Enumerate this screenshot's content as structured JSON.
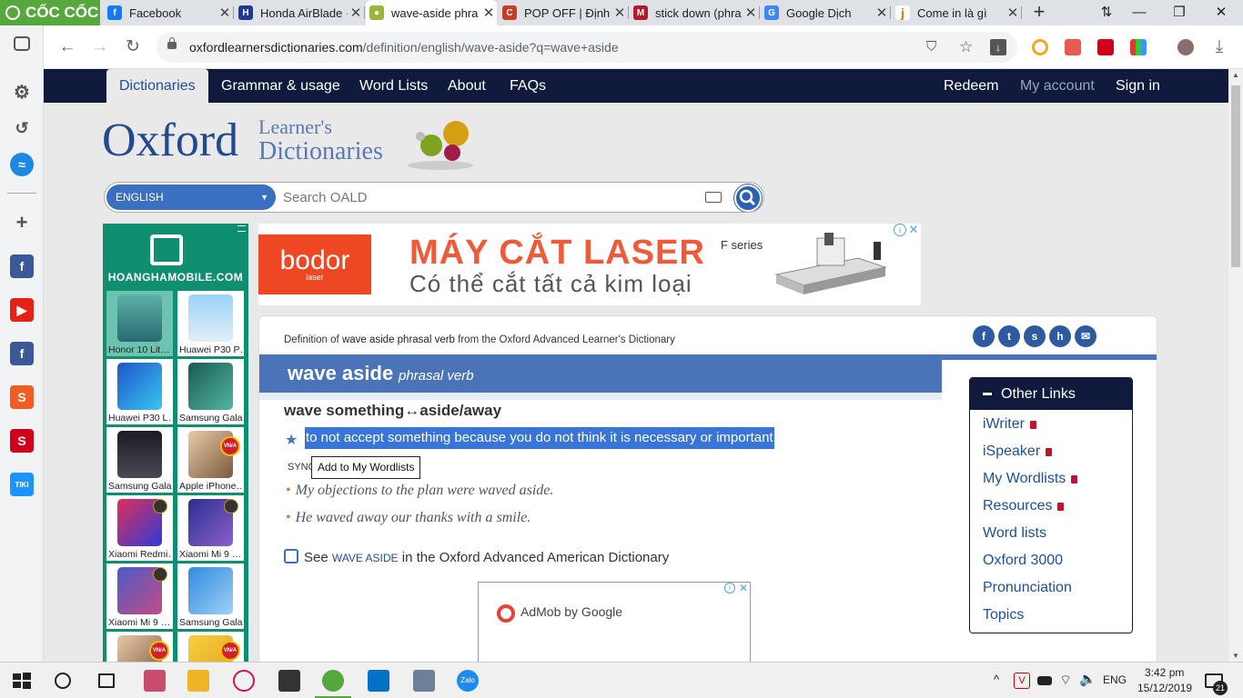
{
  "browser": {
    "brand": "CỐC CỐC",
    "tabs": [
      {
        "title": "Facebook",
        "favicon": "facebook-icon",
        "color": "#1877f2"
      },
      {
        "title": "Honda AirBlade ·",
        "favicon": "honda-icon",
        "color": "#1f3a93"
      },
      {
        "title": "wave-aside phra",
        "favicon": "oxford-icon",
        "color": "#9ab63a",
        "active": true
      },
      {
        "title": "POP OFF | Định n",
        "favicon": "cambridge-icon",
        "color": "#c63c24"
      },
      {
        "title": "stick down (phra",
        "favicon": "macmillan-icon",
        "color": "#b01c2e"
      },
      {
        "title": "Google Dịch",
        "favicon": "google-translate-icon",
        "color": "#4285f4"
      },
      {
        "title": "Come in là gì",
        "favicon": "j-icon",
        "color": "#e07b00"
      }
    ],
    "url_domain": "oxfordlearnersdictionaries.com",
    "url_path": "/definition/english/wave-aside?q=wave+aside"
  },
  "nav": {
    "dictionaries": "Dictionaries",
    "grammar": "Grammar & usage",
    "word_lists": "Word Lists",
    "about": "About",
    "faqs": "FAQs",
    "redeem": "Redeem",
    "my_account": "My account",
    "sign_in": "Sign in"
  },
  "logo": {
    "oxford": "Oxford",
    "learners": "Learner's",
    "dictionaries": "Dictionaries"
  },
  "search": {
    "language": "ENGLISH",
    "placeholder": "Search OALD"
  },
  "left_ad": {
    "brand": "HOANGHAMOBILE.COM",
    "products": [
      "Honor 10 Lit…",
      "Huawei P30 P…",
      "Huawei P30 L…",
      "Samsung Gala…",
      "Samsung Gala…",
      "Apple iPhone…",
      "Xiaomi Redmi…",
      "Xiaomi Mi 9 …",
      "Xiaomi Mi 9 …",
      "Samsung Gala…"
    ]
  },
  "top_ad": {
    "logo": "bodor",
    "logo_sub": "laser",
    "headline": "MÁY CẮT LASER",
    "subline": "Có thể cắt tất cả kim loại",
    "series": "F series"
  },
  "entry": {
    "def_of_prefix": "Definition of",
    "def_of_word": "wave aside phrasal verb",
    "def_of_suffix": "from the Oxford Advanced Learner's Dictionary",
    "headword": "wave aside",
    "pos": "phrasal verb",
    "sense_pattern": "wave something↔aside/away",
    "definition": "to not accept something because you do not think it is necessary or important",
    "synonym_label": "SYNO",
    "tooltip": "Add to My Wordlists",
    "examples": [
      "My objections to the plan were waved aside.",
      "He waved away our thanks with a smile."
    ],
    "see_prefix": "See",
    "see_word": "wave aside",
    "see_suffix": "in the Oxford Advanced American Dictionary"
  },
  "admob": {
    "text": "AdMob by Google"
  },
  "other_links": {
    "title": "Other Links",
    "items": [
      {
        "label": "iWriter",
        "locked": true
      },
      {
        "label": "iSpeaker",
        "locked": true
      },
      {
        "label": "My Wordlists",
        "locked": true
      },
      {
        "label": "Resources",
        "locked": true
      },
      {
        "label": "Word lists",
        "locked": false
      },
      {
        "label": "Oxford 3000",
        "locked": false
      },
      {
        "label": "Pronunciation",
        "locked": false
      },
      {
        "label": "Topics",
        "locked": false
      }
    ]
  },
  "taskbar": {
    "lang": "ENG",
    "time": "3:42 pm",
    "date": "15/12/2019",
    "notifications": "21"
  }
}
